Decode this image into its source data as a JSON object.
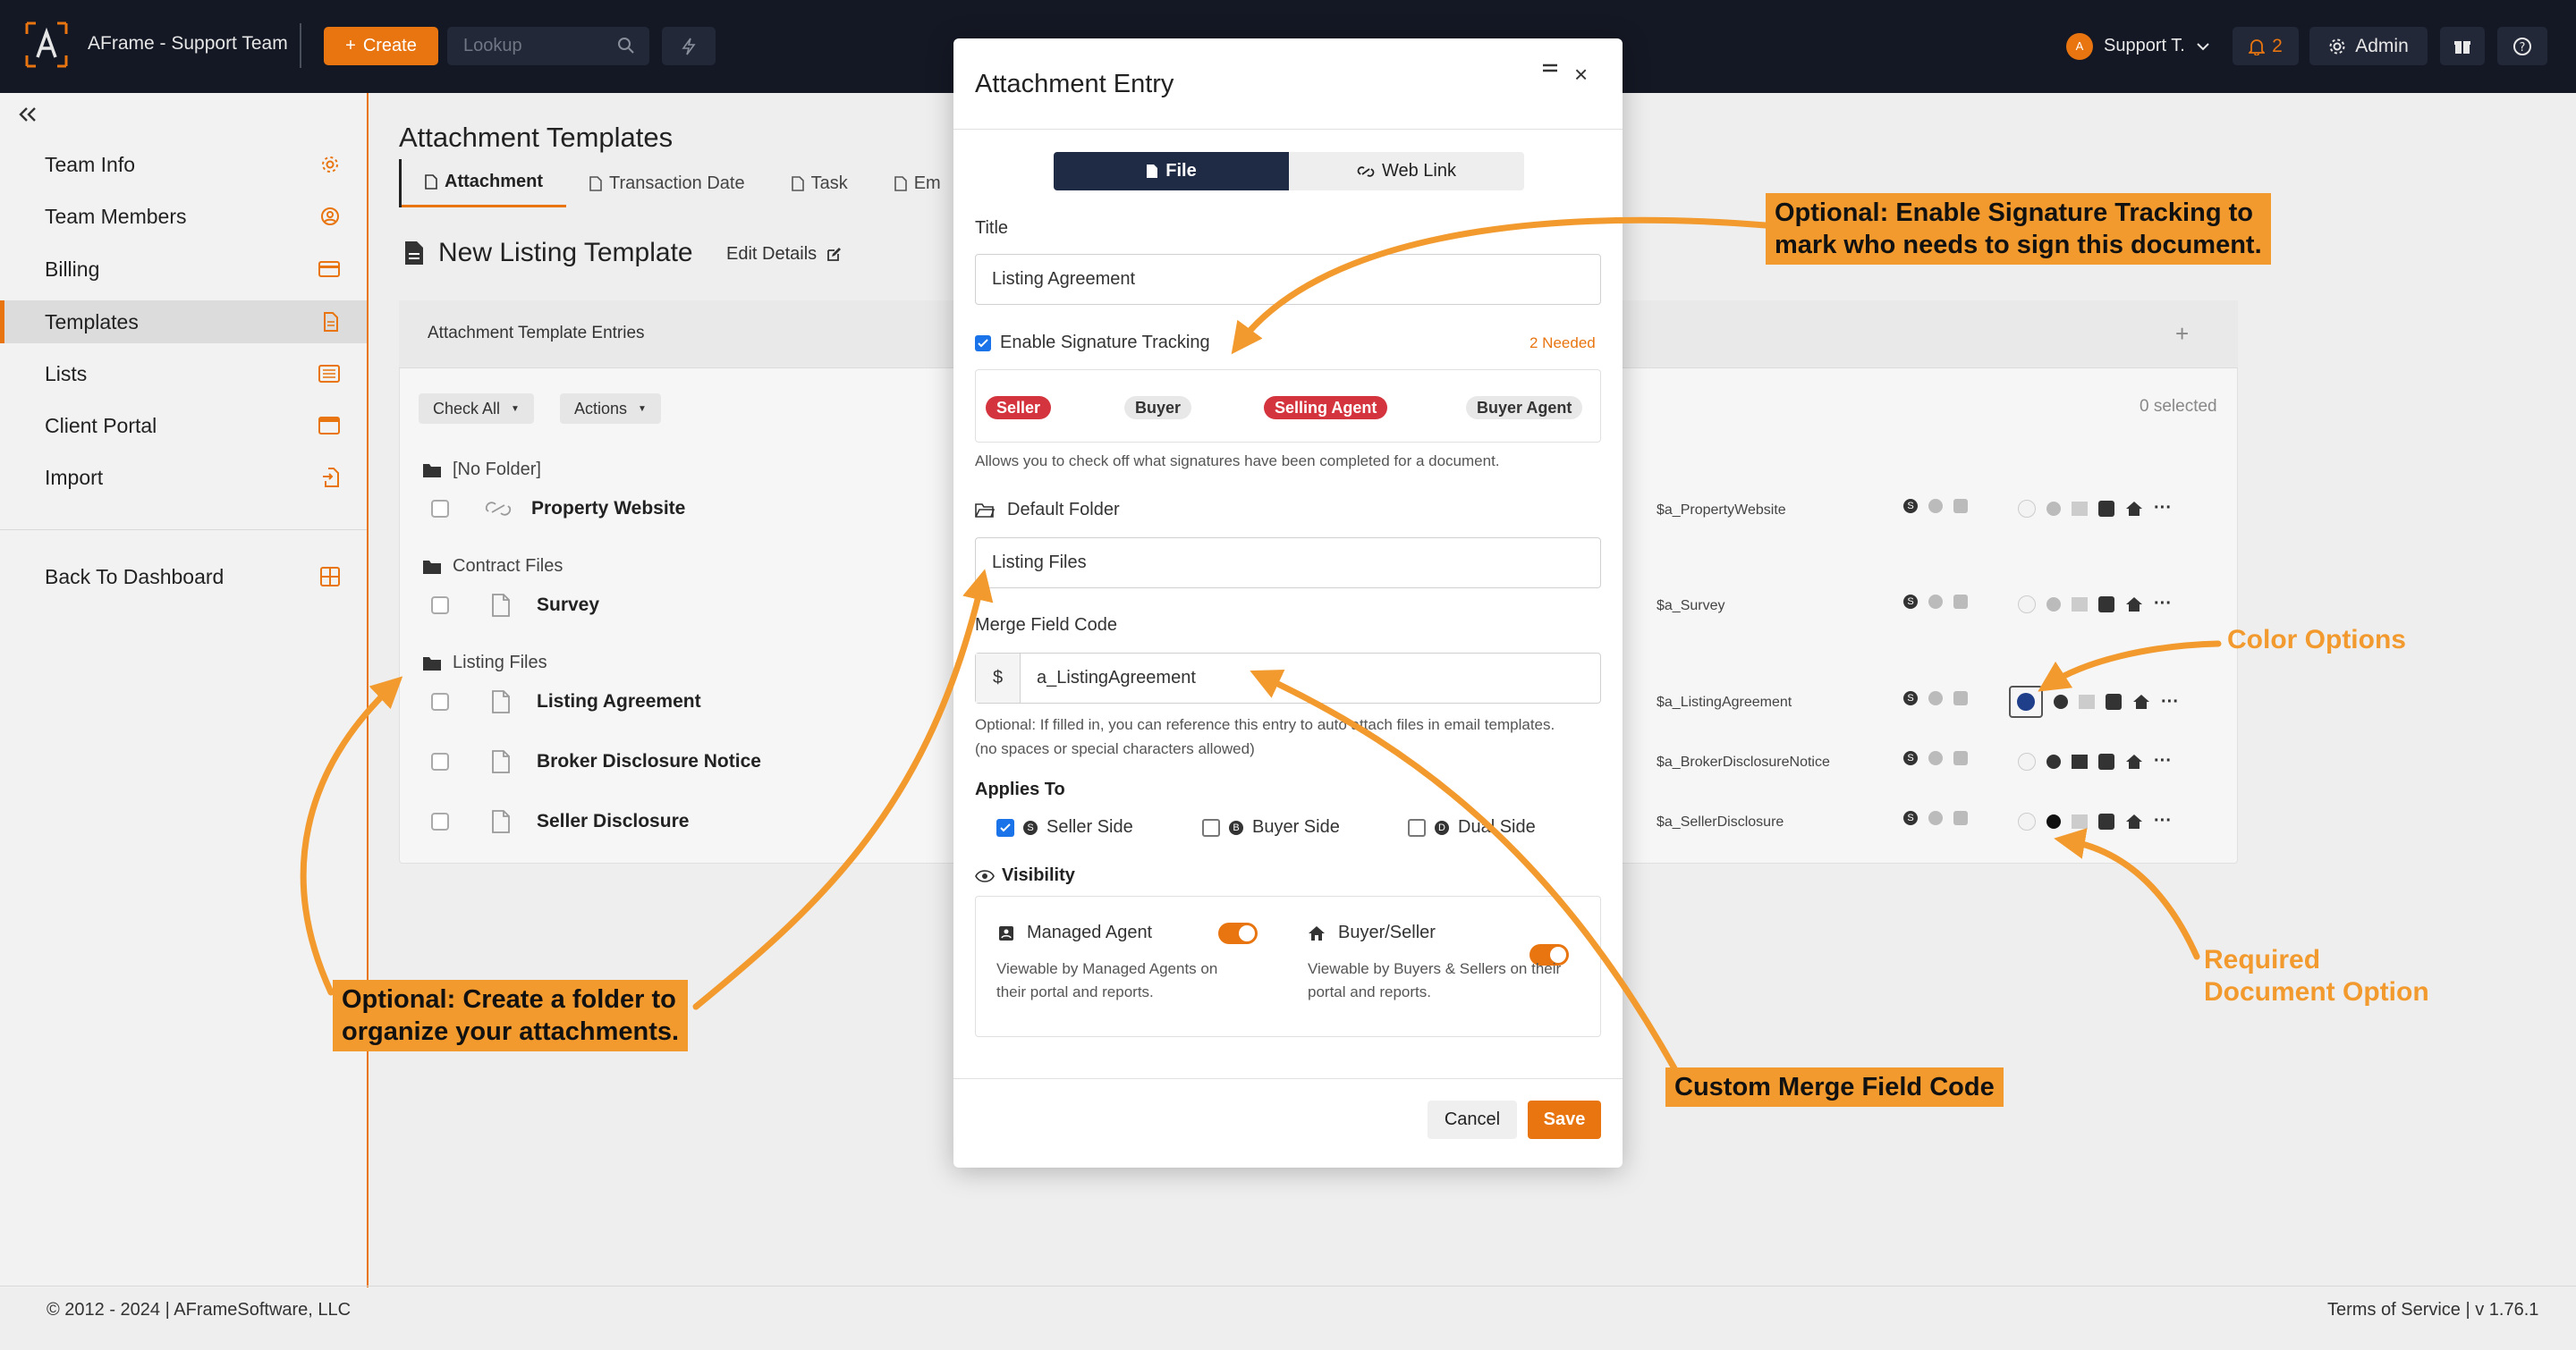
{
  "topbar": {
    "app_name": "AFrame - Support Team",
    "create_label": "Create",
    "lookup_placeholder": "Lookup",
    "avatar_initial": "A",
    "user_label": "Support T.",
    "notif_count": "2",
    "admin_label": "Admin"
  },
  "sidebar": {
    "items": [
      {
        "label": "Team Info",
        "icon": "gear-icon"
      },
      {
        "label": "Team Members",
        "icon": "user-circle-icon"
      },
      {
        "label": "Billing",
        "icon": "credit-card-icon"
      },
      {
        "label": "Templates",
        "icon": "document-icon"
      },
      {
        "label": "Lists",
        "icon": "list-icon"
      },
      {
        "label": "Client Portal",
        "icon": "window-icon"
      },
      {
        "label": "Import",
        "icon": "import-icon"
      }
    ],
    "back_label": "Back To Dashboard"
  },
  "main": {
    "heading": "Attachment Templates",
    "tabs": [
      {
        "label": "Attachment"
      },
      {
        "label": "Transaction Date"
      },
      {
        "label": "Task"
      },
      {
        "label": "Em"
      }
    ],
    "page_title": "New Listing Template",
    "edit_details": "Edit Details",
    "panel_title": "Attachment Template Entries",
    "check_all": "Check All",
    "actions": "Actions",
    "selected_count": "0 selected",
    "folders": [
      {
        "name": "[No Folder]",
        "entries": [
          {
            "name": "Property Website",
            "code": "$a_PropertyWebsite",
            "kind": "link"
          }
        ]
      },
      {
        "name": "Contract Files",
        "entries": [
          {
            "name": "Survey",
            "code": "$a_Survey",
            "kind": "file"
          }
        ]
      },
      {
        "name": "Listing Files",
        "entries": [
          {
            "name": "Listing Agreement",
            "code": "$a_ListingAgreement",
            "kind": "file"
          },
          {
            "name": "Broker Disclosure Notice",
            "code": "$a_BrokerDisclosureNotice",
            "kind": "file"
          },
          {
            "name": "Seller Disclosure",
            "code": "$a_SellerDisclosure",
            "kind": "file"
          }
        ]
      }
    ],
    "side_letter": "S"
  },
  "footer": {
    "copyright": "© 2012 - 2024 | AFrameSoftware, LLC",
    "terms": "Terms of Service | v 1.76.1"
  },
  "modal": {
    "title": "Attachment Entry",
    "close_glyph": "×",
    "seg_file": "File",
    "seg_link": "Web Link",
    "title_label": "Title",
    "title_value": "Listing Agreement",
    "sig_label": "Enable Signature Tracking",
    "sig_needed": "2 Needed",
    "pills": [
      "Seller",
      "Buyer",
      "Selling Agent",
      "Buyer Agent"
    ],
    "sig_help": "Allows you to check off what signatures have been completed for a document.",
    "folder_label": "Default Folder",
    "folder_value": "Listing Files",
    "merge_label": "Merge Field Code",
    "merge_prefix": "$",
    "merge_value": "a_ListingAgreement",
    "merge_help_1": "Optional: If filled in, you can reference this entry to auto attach files in email templates.",
    "merge_help_2": "(no spaces or special characters allowed)",
    "applies_label": "Applies To",
    "seller_side": "Seller Side",
    "buyer_side": "Buyer Side",
    "dual_side": "Dual Side",
    "seller_badge": "S",
    "buyer_badge": "B",
    "dual_badge": "D",
    "visibility_label": "Visibility",
    "managed_agent": "Managed Agent",
    "managed_help_1": "Viewable by Managed Agents on",
    "managed_help_2": "their portal and reports.",
    "buyer_seller": "Buyer/Seller",
    "bs_help_1": "Viewable by Buyers & Sellers on their",
    "bs_help_2": "portal and reports.",
    "cancel": "Cancel",
    "save": "Save"
  },
  "callouts": {
    "sig_1": "Optional: Enable Signature Tracking to",
    "sig_2": "mark who needs to sign this document.",
    "folder_1": "Optional: Create a folder to",
    "folder_2": "organize your attachments.",
    "merge": "Custom Merge Field Code",
    "color": "Color Options",
    "required_1": "Required",
    "required_2": "Document Option"
  },
  "colors": {
    "accent": "#e8750f",
    "callout": "#f29a2e",
    "topbar": "#141824",
    "pill_red": "#d4343e",
    "segment_active": "#1f2a44"
  }
}
